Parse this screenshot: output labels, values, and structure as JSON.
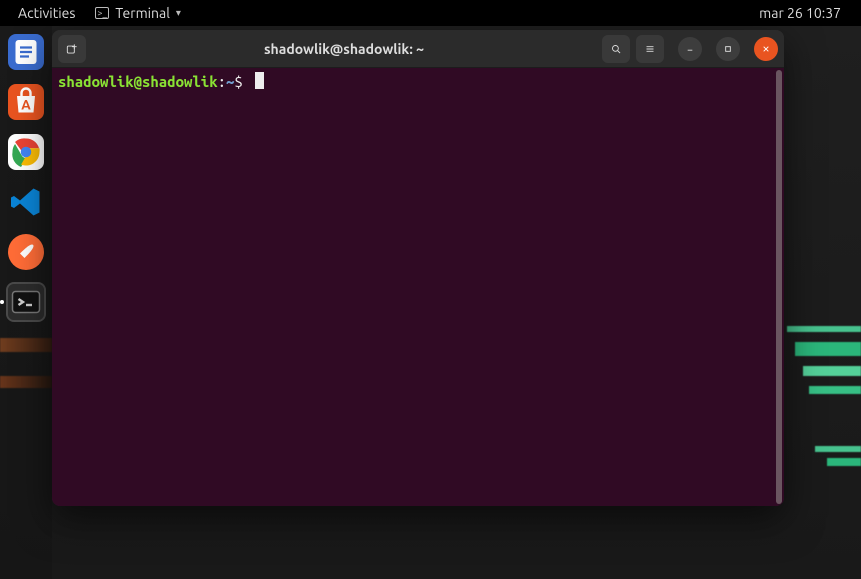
{
  "topbar": {
    "activities_label": "Activities",
    "app_menu_label": "Terminal",
    "clock": "mar 26  10:37"
  },
  "dock": {
    "items": [
      {
        "name": "notes-app"
      },
      {
        "name": "software-center"
      },
      {
        "name": "chrome"
      },
      {
        "name": "vscode"
      },
      {
        "name": "postman"
      },
      {
        "name": "terminal"
      }
    ]
  },
  "terminal": {
    "title": "shadowlik@shadowlik: ~",
    "prompt_userhost": "shadowlik@shadowlik",
    "prompt_colon": ":",
    "prompt_path": "~",
    "prompt_dollar": "$"
  }
}
